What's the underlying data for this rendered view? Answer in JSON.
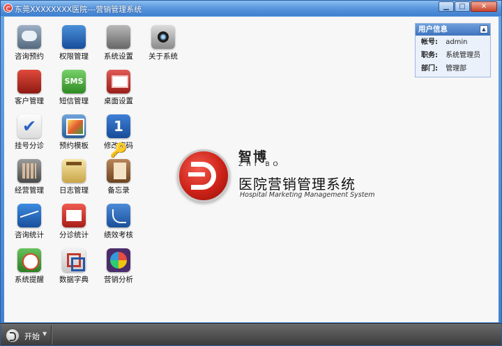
{
  "window": {
    "title": "东莞XXXXXXXX医院---营销管理系统",
    "buttons": {
      "minimize": "▁",
      "maximize": "□",
      "close": "✕"
    }
  },
  "apps": [
    {
      "label": "咨询预约",
      "icon": "chat-bubbles-icon"
    },
    {
      "label": "权限管理",
      "icon": "user-group-icon"
    },
    {
      "label": "系统设置",
      "icon": "gear-icon"
    },
    {
      "label": "关于系统",
      "icon": "camera-lens-icon"
    },
    {
      "label": "客户管理",
      "icon": "customer-icon"
    },
    {
      "label": "短信管理",
      "icon": "sms-icon",
      "glyph": "SMS"
    },
    {
      "label": "桌面设置",
      "icon": "desktop-icon"
    },
    {
      "label": "挂号分诊",
      "icon": "checkmark-icon",
      "glyph": "✔"
    },
    {
      "label": "预约模板",
      "icon": "photo-frame-icon"
    },
    {
      "label": "修改密码",
      "icon": "key-icon",
      "glyph": "1🔑"
    },
    {
      "label": "经营管理",
      "icon": "calculator-icon"
    },
    {
      "label": "日志管理",
      "icon": "notepad-icon"
    },
    {
      "label": "备忘录",
      "icon": "address-book-icon"
    },
    {
      "label": "咨询统计",
      "icon": "line-chart-icon"
    },
    {
      "label": "分诊统计",
      "icon": "calendar-icon"
    },
    {
      "label": "绩效考核",
      "icon": "curve-chart-icon"
    },
    {
      "label": "系统提醒",
      "icon": "alarm-clock-icon"
    },
    {
      "label": "数据字典",
      "icon": "dictionary-icon"
    },
    {
      "label": "营销分析",
      "icon": "pie-chart-icon"
    }
  ],
  "brand": {
    "name_cn": "智博",
    "name_en": "ZHI BO",
    "system_cn": "医院营销管理系统",
    "system_en": "Hospital Marketing Management System"
  },
  "user_panel": {
    "title": "用户信息",
    "collapse": "▲",
    "rows": [
      {
        "key": "帐号:",
        "value": "admin"
      },
      {
        "key": "职务:",
        "value": "系统管理员"
      },
      {
        "key": "部门:",
        "value": "管理部"
      }
    ]
  },
  "taskbar": {
    "start_label": "开始",
    "start_arrow": "▼"
  },
  "colors": {
    "accent": "#3f7fcf",
    "brand_red": "#cd2218",
    "taskbar": "#4a4a4a"
  }
}
